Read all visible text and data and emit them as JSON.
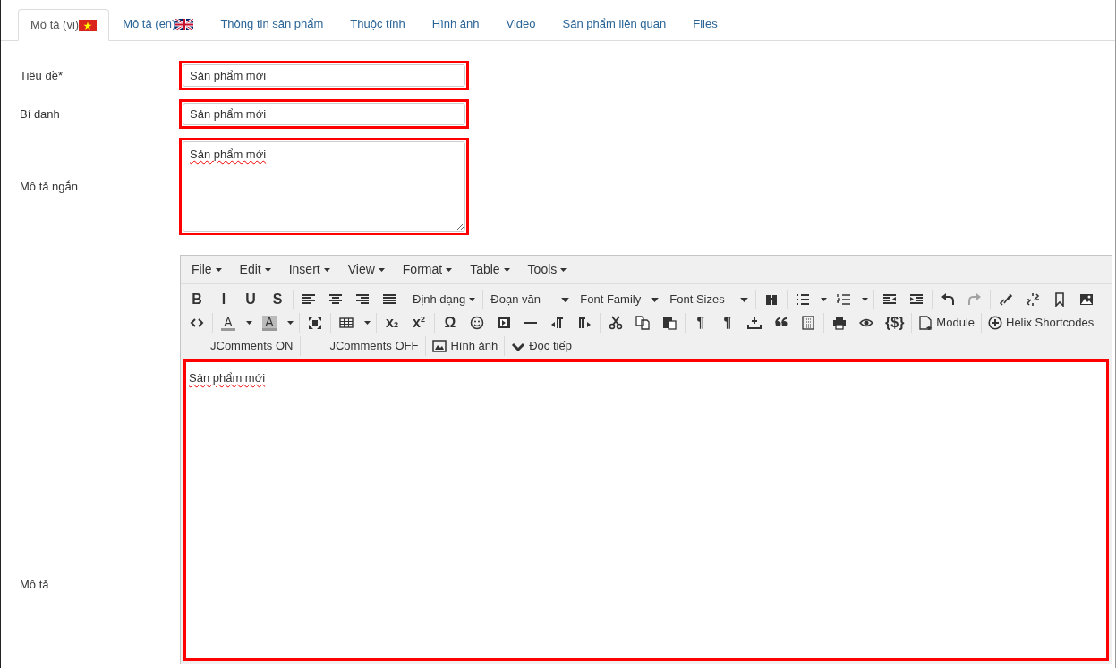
{
  "tabs": [
    {
      "label": "Mô tả (vi)",
      "kind": "lang",
      "selected": true
    },
    {
      "label": "Mô tả (en)",
      "kind": "lang",
      "selected": false
    },
    {
      "label": "Thông tin sản phẩm",
      "kind": "plain",
      "selected": false
    },
    {
      "label": "Thuộc tính",
      "kind": "plain",
      "selected": false
    },
    {
      "label": "Hình ảnh",
      "kind": "plain",
      "selected": false
    },
    {
      "label": "Video",
      "kind": "plain",
      "selected": false
    },
    {
      "label": "Sản phẩm liên quan",
      "kind": "plain",
      "selected": false
    },
    {
      "label": "Files",
      "kind": "plain",
      "selected": false
    }
  ],
  "fields": [
    {
      "label": "Tiêu đề*",
      "kind": "input",
      "value": "Sản phẩm mới"
    },
    {
      "label": "Bí danh",
      "kind": "input",
      "value": "Sản phẩm mới"
    },
    {
      "label": "Mô tả ngắn",
      "kind": "textarea",
      "value": "Sản phẩm mới"
    }
  ],
  "editor": {
    "label": "Mô tả",
    "menus": [
      "File",
      "Edit",
      "Insert",
      "View",
      "Format",
      "Table",
      "Tools"
    ],
    "toolbar_rows": [
      [
        {
          "kind": "glyph",
          "text": "B"
        },
        {
          "kind": "glyph",
          "text": "I"
        },
        {
          "kind": "glyph",
          "text": "U"
        },
        {
          "kind": "glyph",
          "text": "S"
        },
        {
          "kind": "separator"
        },
        {
          "kind": "icon",
          "disabled": false
        },
        {
          "kind": "icon",
          "disabled": false
        },
        {
          "kind": "icon",
          "disabled": false
        },
        {
          "kind": "icon",
          "disabled": false
        },
        {
          "kind": "separator"
        },
        {
          "kind": "dropdown",
          "label": "Định dạng"
        },
        {
          "kind": "separator"
        },
        {
          "kind": "select",
          "label": "Đoạn văn"
        },
        {
          "kind": "select",
          "label": "Font Family"
        },
        {
          "kind": "select",
          "label": "Font Sizes"
        },
        {
          "kind": "separator"
        },
        {
          "kind": "icon",
          "disabled": false
        },
        {
          "kind": "separator"
        },
        {
          "kind": "icon",
          "disabled": false
        },
        {
          "kind": "split"
        },
        {
          "kind": "icon",
          "disabled": false
        },
        {
          "kind": "split"
        },
        {
          "kind": "separator"
        },
        {
          "kind": "icon",
          "disabled": false
        },
        {
          "kind": "icon",
          "disabled": false
        },
        {
          "kind": "separator"
        },
        {
          "kind": "icon",
          "disabled": false
        },
        {
          "kind": "icon",
          "disabled": true
        },
        {
          "kind": "separator"
        },
        {
          "kind": "icon",
          "disabled": false
        },
        {
          "kind": "icon",
          "disabled": false
        },
        {
          "kind": "icon",
          "disabled": false
        },
        {
          "kind": "icon",
          "disabled": false
        }
      ],
      [
        {
          "kind": "icon",
          "disabled": false
        },
        {
          "kind": "separator"
        },
        {
          "kind": "forecolor",
          "text": "A"
        },
        {
          "kind": "split"
        },
        {
          "kind": "backcolor",
          "text": "A"
        },
        {
          "kind": "split"
        },
        {
          "kind": "separator"
        },
        {
          "kind": "icon",
          "disabled": false
        },
        {
          "kind": "separator"
        },
        {
          "kind": "icon",
          "disabled": false
        },
        {
          "kind": "split"
        },
        {
          "kind": "separator"
        },
        {
          "kind": "glyph",
          "text": "x$_{2}$"
        },
        {
          "kind": "glyph",
          "text": "x$^{2}$"
        },
        {
          "kind": "separator"
        },
        {
          "kind": "glyph",
          "text": "Ω"
        },
        {
          "kind": "icon",
          "disabled": false
        },
        {
          "kind": "icon",
          "disabled": false
        },
        {
          "kind": "icon",
          "disabled": false
        },
        {
          "kind": "icon",
          "disabled": false
        },
        {
          "kind": "icon",
          "disabled": false
        },
        {
          "kind": "separator"
        },
        {
          "kind": "icon",
          "disabled": false
        },
        {
          "kind": "icon",
          "disabled": false
        },
        {
          "kind": "icon",
          "disabled": false
        },
        {
          "kind": "separator"
        },
        {
          "kind": "glyph",
          "text": "¶"
        },
        {
          "kind": "glyph",
          "text": "¶"
        },
        {
          "kind": "icon",
          "disabled": false
        },
        {
          "kind": "icon",
          "disabled": false
        },
        {
          "kind": "icon",
          "disabled": false
        },
        {
          "kind": "separator"
        },
        {
          "kind": "icon",
          "disabled": false
        },
        {
          "kind": "icon",
          "disabled": false
        },
        {
          "kind": "glyph",
          "text": "{$}"
        },
        {
          "kind": "separator"
        },
        {
          "kind": "button",
          "label": "Module"
        },
        {
          "kind": "separator"
        },
        {
          "kind": "button",
          "label": "Helix Shortcodes"
        }
      ],
      [
        {
          "kind": "text",
          "label": "JComments ON"
        },
        {
          "kind": "separator"
        },
        {
          "kind": "text",
          "label": "JComments OFF"
        },
        {
          "kind": "separator"
        },
        {
          "kind": "button",
          "label": "Hình ảnh"
        },
        {
          "kind": "separator"
        },
        {
          "kind": "button",
          "label": "Đọc tiếp"
        }
      ]
    ],
    "content": "Sản phẩm mới"
  }
}
